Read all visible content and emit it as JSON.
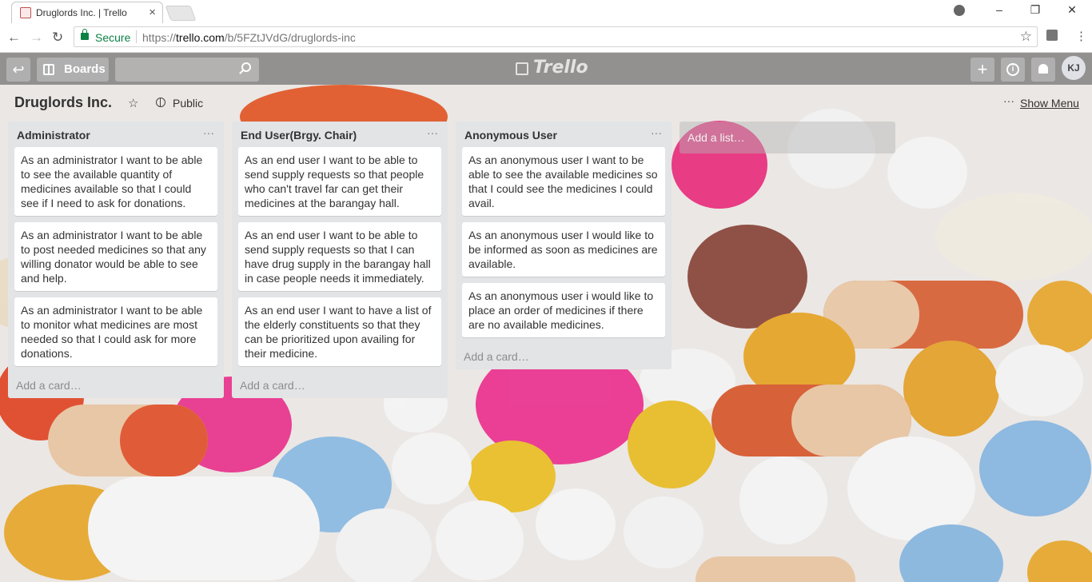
{
  "browser": {
    "tab_title": "Druglords Inc. | Trello",
    "secure_label": "Secure",
    "url_scheme": "https://",
    "url_host": "trello.com",
    "url_path": "/b/5FZtJVdG/druglords-inc"
  },
  "header": {
    "boards_label": "Boards",
    "logo_text": "Trello",
    "avatar_initials": "KJ"
  },
  "board": {
    "title": "Druglords Inc.",
    "visibility": "Public",
    "show_menu_label": "Show Menu"
  },
  "lists": [
    {
      "title": "Administrator",
      "cards": [
        "As an administrator I want to be able to see the available quantity of medicines available so that I could see if I need to ask for donations.",
        "As an administrator I want to be able to post needed medicines so that any willing donator would be able to see and help.",
        "As an administrator I want to be able to monitor what medicines are most needed so that I could ask for more donations."
      ],
      "add_card_label": "Add a card…"
    },
    {
      "title": "End User(Brgy. Chair)",
      "cards": [
        "As an end user I want to be able to send supply requests so that people who can't travel far can get their medicines at the barangay hall.",
        "As an end user I want to be able to send supply requests so that I can have drug supply in the barangay hall in case people needs it immediately.",
        "As an end user I want to have a list of the elderly constituents so that they can be prioritized upon availing for their medicine."
      ],
      "add_card_label": "Add a card…"
    },
    {
      "title": "Anonymous User",
      "cards": [
        "As an anonymous user I want to be able to see the available medicines so that I could see the medicines I could avail.",
        "As an anonymous user I would like to be informed as soon as medicines are available.",
        "As an anonymous user i would like to place an order of medicines if there are no available medicines."
      ],
      "add_card_label": "Add a card…"
    }
  ],
  "add_list_label": "Add a list…",
  "colors": {
    "header_bg": "#7a7a7a",
    "list_bg": "#e2e4e6",
    "secure_green": "#0b8043"
  }
}
